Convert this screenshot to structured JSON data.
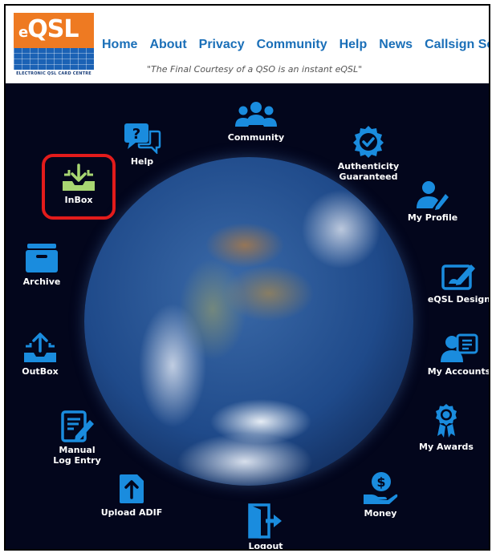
{
  "logo": {
    "text": "QSL",
    "e": "e",
    "caption": "ELECTRONIC QSL CARD CENTRE"
  },
  "nav": [
    {
      "label": "Home"
    },
    {
      "label": "About"
    },
    {
      "label": "Privacy"
    },
    {
      "label": "Community"
    },
    {
      "label": "Help"
    },
    {
      "label": "News"
    },
    {
      "label": "Callsign Search"
    }
  ],
  "tagline": "\"The Final Courtesy of a QSO is an instant eQSL\"",
  "colors": {
    "icon_blue": "#1a8cde",
    "inbox_green": "#a8d672",
    "highlight_red": "#e31b1b",
    "background": "#03061c",
    "nav_blue": "#1a6fb8"
  },
  "dashboard": {
    "community": "Community",
    "help": "Help",
    "authenticity": "Authenticity Guaranteed",
    "inbox": "InBox",
    "my_profile": "My Profile",
    "archive": "Archive",
    "eqsl_design": "eQSL Design",
    "outbox": "OutBox",
    "my_accounts": "My Accounts",
    "manual_log": "Manual Log Entry",
    "my_awards": "My Awards",
    "upload_adif": "Upload ADIF",
    "money": "Money",
    "logout": "Logout"
  }
}
